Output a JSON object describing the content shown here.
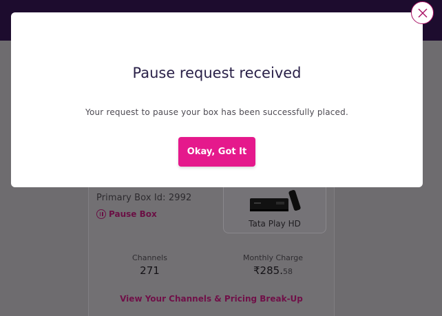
{
  "modal": {
    "title": "Pause request received",
    "message": "Your request to pause your box has been successfully placed.",
    "ok_label": "Okay, Got It"
  },
  "box": {
    "primary_box_id": "Primary Box Id: 2992",
    "pause_label": "Pause Box",
    "device_name": "Tata Play HD"
  },
  "stats": {
    "channels_label": "Channels",
    "channels_value": "271",
    "charge_label": "Monthly Charge",
    "charge_value": "₹285.",
    "charge_decimals": "58"
  },
  "links": {
    "pricing": "View Your Channels & Pricing Break-Up"
  },
  "colors": {
    "accent": "#e5198c",
    "topbar": "#1d0c2e",
    "close_border": "#a80f63"
  },
  "icons": [
    "close-icon",
    "pause-icon",
    "set-top-box-image"
  ]
}
